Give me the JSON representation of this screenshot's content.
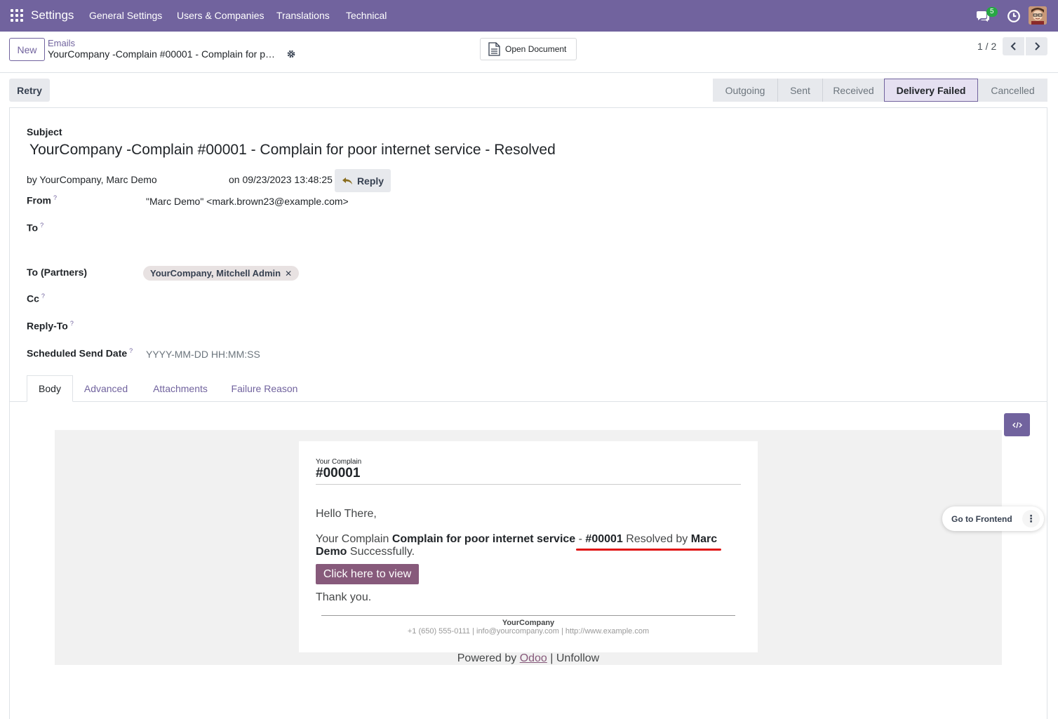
{
  "topnav": {
    "brand": "Settings",
    "menu": [
      "General Settings",
      "Users & Companies",
      "Translations",
      "Technical"
    ],
    "chat_badge": "5"
  },
  "control_panel": {
    "new_label": "New",
    "breadcrumb_parent": "Emails",
    "breadcrumb_current": "YourCompany -Complain #00001 - Complain for p…",
    "open_document_label": "Open Document",
    "pager": "1 / 2"
  },
  "actions": {
    "retry_label": "Retry"
  },
  "statusbar": {
    "stages": [
      "Outgoing",
      "Sent",
      "Received",
      "Delivery Failed",
      "Cancelled"
    ],
    "active": "Delivery Failed"
  },
  "form": {
    "subject_label": "Subject",
    "subject": "YourCompany -Complain  #00001 - Complain for poor internet service - Resolved",
    "by_text": "by  YourCompany, Marc Demo",
    "on_text": "on 09/23/2023 13:48:25",
    "reply_label": "Reply",
    "from_label": "From",
    "from_value": "\"Marc Demo\" <mark.brown23@example.com>",
    "to_label": "To",
    "to_partners_label": "To (Partners)",
    "to_partners_tag": "YourCompany, Mitchell Admin",
    "cc_label": "Cc",
    "reply_to_label": "Reply-To",
    "scheduled_label": "Scheduled Send Date",
    "scheduled_placeholder": "YYYY-MM-DD HH:MM:SS",
    "help_mark": "?"
  },
  "tabs": [
    "Body",
    "Advanced",
    "Attachments",
    "Failure Reason"
  ],
  "email": {
    "small_title": "Your Complain",
    "number": "#00001",
    "greeting": "Hello There,",
    "line_prefix": "Your Complain ",
    "line_subject": "Complain for poor internet service",
    "line_dash": " - ",
    "line_number": "#00001",
    "line_resolved": " Resolved by ",
    "line_name": "Marc",
    "line_name2": "Demo",
    "line_suffix": " Successfully.",
    "button": "Click here to view",
    "thanks": "Thank you.",
    "company": "YourCompany",
    "contact": "+1 (650) 555-0111 | info@yourcompany.com | http://www.example.com",
    "powered_prefix": "Powered by ",
    "powered_link": "Odoo",
    "powered_suffix": " | Unfollow"
  },
  "frontend": {
    "label": "Go to Frontend"
  }
}
